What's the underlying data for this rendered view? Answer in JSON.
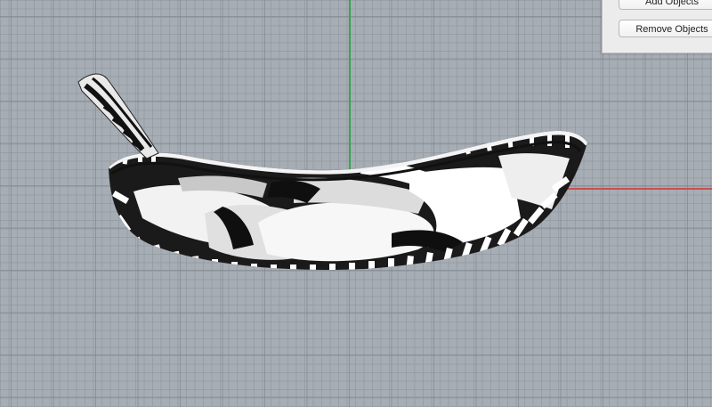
{
  "panel": {
    "add_objects_label": "Add Objects",
    "remove_objects_label": "Remove Objects"
  },
  "viewport": {
    "background_color": "#a7adb4",
    "grid_color": "#969ca4",
    "y_axis_color": "#2fa84a",
    "x_axis_color": "#c9504e",
    "model": "zebra-striped banana-shaped bowl"
  }
}
